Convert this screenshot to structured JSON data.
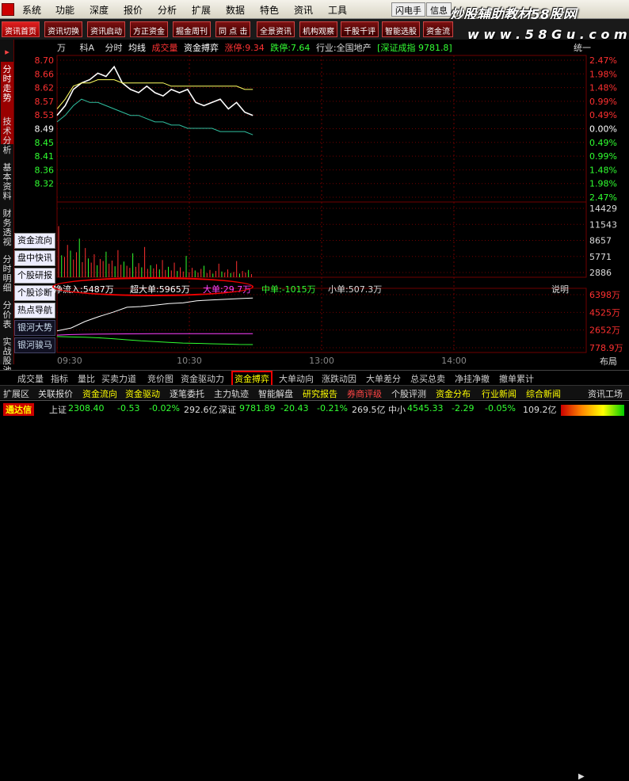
{
  "menu": [
    "系统",
    "功能",
    "深度",
    "报价",
    "分析",
    "扩展",
    "数据",
    "特色",
    "资讯",
    "工具"
  ],
  "menu_buttons": [
    "闪电手",
    "信息"
  ],
  "watermark": {
    "title": "炒股辅助教材58股网",
    "url": "w w w . 5 8 G u . c o m"
  },
  "toolbar": [
    "资讯首页",
    "资讯切换",
    "资讯启动",
    "方正资金",
    "掘金周刊",
    "同 点 击",
    "全景资讯",
    "机构观察",
    "千股千评",
    "智能选股",
    "资金流"
  ],
  "left_nav": [
    "分时走势",
    "技术分析",
    "基本资料",
    "财务透视",
    "分时明细",
    "分价表",
    "实战股池"
  ],
  "side_buttons": [
    "资金流向",
    "盘中快讯",
    "个股研报",
    "个股诊断",
    "热点导航",
    "银河大势",
    "银河骏马"
  ],
  "header": {
    "unit": "万",
    "code": "科A",
    "mode": "分时",
    "avg_line": "均线",
    "vol": "成交量",
    "fund": "资金搏弈",
    "limit_up": "涨停:9.34",
    "limit_down": "跌停:7.64",
    "industry": "行业:全国地产",
    "index": "[深证成指 9781.8]",
    "unify": "统一"
  },
  "price_axis": [
    "8.70",
    "8.66",
    "8.62",
    "8.57",
    "8.53",
    "8.49",
    "8.45",
    "8.41",
    "8.36",
    "8.32"
  ],
  "pct_axis": [
    "2.47%",
    "1.98%",
    "1.48%",
    "0.99%",
    "0.49%",
    "0.00%",
    "0.49%",
    "0.99%",
    "1.48%",
    "1.98%",
    "2.47%"
  ],
  "vol_axis": [
    "14429",
    "11543",
    "8657",
    "5771",
    "2886"
  ],
  "flow_axis": [
    "6398万",
    "4525万",
    "2652万",
    "778.9万"
  ],
  "time_axis": [
    "09:30",
    "10:30",
    "13:00",
    "14:00"
  ],
  "flow_row": {
    "net": "净流入:5487万",
    "super": "超大单:5965万",
    "big": "大单:29.7万",
    "mid": "中单:-1015万",
    "small": "小单:507.3万",
    "explain": "说明"
  },
  "layout_label": "布局",
  "tabs1": [
    "成交量",
    "指标",
    "量比",
    "买卖力道",
    "竞价图",
    "资金驱动力",
    "资金搏弈",
    "大单动向",
    "涨跌动因",
    "大单差分",
    "总买总卖",
    "净挂净撤",
    "撤单累计"
  ],
  "tabs2": [
    "扩展区",
    "关联报价",
    "资金流向",
    "资金驱动",
    "逐笔委托",
    "主力轨迹",
    "智能解盘",
    "研究报告",
    "券商评级",
    "个股评测",
    "资金分布",
    "行业新闻",
    "综合新闻",
    "资讯工场"
  ],
  "status": {
    "brand": "通达信",
    "sh_label": "上证",
    "sh_val": "2308.40",
    "sh_chg": "-0.53",
    "sh_pct": "-0.02%",
    "sh_amt": "292.6亿",
    "sz_label": "深证",
    "sz_val": "9781.89",
    "sz_chg": "-20.43",
    "sz_pct": "-0.21%",
    "sz_amt": "269.5亿",
    "zx_label": "中小",
    "zx_val": "4545.33",
    "zx_chg": "-2.29",
    "zx_pct": "-0.05%",
    "zx_amt": "109.2亿"
  },
  "colors": {
    "up": "#ff3030",
    "down": "#30ff30",
    "price_line": "#ffffff",
    "avg_line": "#ffff60",
    "grid": "#700000",
    "axis_text": "#c0c0c0"
  },
  "chart_data": [
    {
      "type": "line",
      "title": "",
      "xlabel": "",
      "ylabel": "",
      "x_range": [
        "09:30",
        "15:00"
      ],
      "ylim": [
        8.32,
        8.7
      ],
      "series": [
        {
          "values": [
            8.53,
            8.56,
            8.61,
            8.63,
            8.64,
            8.66,
            8.65,
            8.68,
            8.63,
            8.61,
            8.6,
            8.62,
            8.6,
            8.59,
            8.61,
            8.6,
            8.61,
            8.57,
            8.56,
            8.57,
            8.58,
            8.55,
            8.57,
            8.54,
            8.53
          ]
        },
        {
          "values": [
            8.55,
            8.58,
            8.62,
            8.63,
            8.63,
            8.64,
            8.64,
            8.64,
            8.63,
            8.63,
            8.63,
            8.63,
            8.63,
            8.63,
            8.62,
            8.62,
            8.62,
            8.62,
            8.62,
            8.62,
            8.62,
            8.62,
            8.62,
            8.61,
            8.61
          ]
        },
        {
          "values": [
            8.51,
            8.53,
            8.56,
            8.58,
            8.57,
            8.57,
            8.56,
            8.55,
            8.54,
            8.53,
            8.53,
            8.52,
            8.51,
            8.51,
            8.5,
            8.5,
            8.49,
            8.49,
            8.49,
            8.49,
            8.48,
            8.48,
            8.48,
            8.48,
            8.47
          ]
        }
      ]
    },
    {
      "type": "bar",
      "title": "",
      "ylim": [
        0,
        14429
      ],
      "values": [
        9800,
        4200,
        3900,
        6200,
        5100,
        3400,
        4800,
        7400,
        2900,
        5600,
        3600,
        2800,
        4400,
        2300,
        3500,
        3100,
        4900,
        2600,
        3200,
        2100,
        5200,
        2400,
        3000,
        2200,
        1800,
        4600,
        2000,
        2700,
        1900,
        5800,
        1600,
        2300,
        1700,
        2500,
        1500,
        3300,
        1400,
        2000,
        1300,
        2800,
        1200,
        1900,
        1100,
        4100,
        1000,
        1800,
        1300,
        900,
        1600,
        2200,
        800,
        1400,
        700,
        1200,
        2600,
        1100,
        900,
        1500,
        800,
        1000,
        3100,
        700,
        1200,
        900,
        1400,
        600
      ]
    },
    {
      "type": "line",
      "title": "",
      "ylim": [
        0,
        6398
      ],
      "series": [
        {
          "values": [
            900,
            1300,
            2200,
            2900,
            3500,
            4200,
            4300,
            4500,
            4700,
            4800,
            5100,
            5200,
            5300,
            5400,
            5487
          ]
        },
        {
          "values": [
            300,
            380,
            420,
            450,
            470,
            480,
            490,
            500,
            505,
            507,
            507,
            507,
            507,
            507,
            507
          ]
        },
        {
          "values": [
            100,
            50,
            0,
            -80,
            -200,
            -350,
            -500,
            -600,
            -700,
            -800,
            -850,
            -900,
            -950,
            -1000,
            -1015
          ]
        }
      ]
    }
  ]
}
